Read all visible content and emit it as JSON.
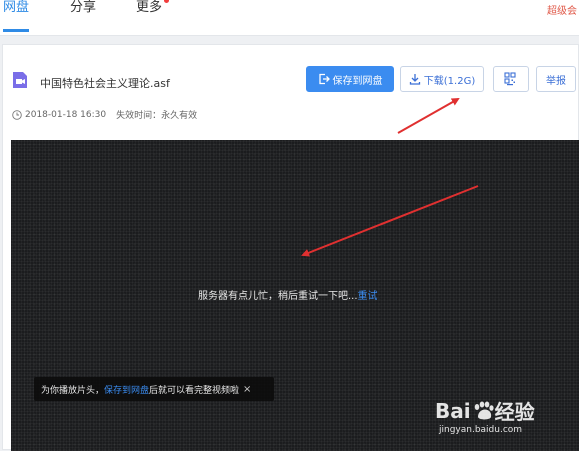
{
  "nav": {
    "tabs": [
      {
        "label": "网盘",
        "active": true
      },
      {
        "label": "分享",
        "active": false
      },
      {
        "label": "更多",
        "active": false
      }
    ],
    "right_text": "超级会"
  },
  "file": {
    "name": "中国特色社会主义理论.asf",
    "date": "2018-01-18 16:30",
    "expiry": "失效时间：永久有效"
  },
  "toolbar": {
    "save_label": "保存到网盘",
    "download_label": "下载(1.2G)",
    "report_label": "举报"
  },
  "video": {
    "message": "服务器有点儿忙，稍后重试一下吧...",
    "retry_label": "重试"
  },
  "toast": {
    "prefix": "为你播放片头，",
    "link": "保存到网盘",
    "suffix": "后就可以看完整视频啦",
    "close": "×"
  },
  "watermark": {
    "brand_left": "Bai",
    "brand_right": "经验",
    "url": "jingyan.baidu.com"
  },
  "colors": {
    "accent": "#3b8cf0",
    "annotation_arrow": "#e03030"
  }
}
